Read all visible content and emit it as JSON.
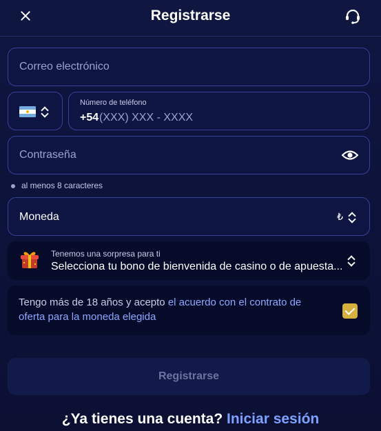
{
  "header": {
    "title": "Registrarse"
  },
  "form": {
    "email_placeholder": "Correo electrónico",
    "phone_label": "Número de teléfono",
    "phone_code": "+54",
    "phone_mask": "(XXX) XXX - XXXX",
    "password_placeholder": "Contraseña",
    "password_hint": "al menos 8 caracteres",
    "currency_label": "Moneda",
    "currency_symbol": "₺"
  },
  "bonus": {
    "small": "Tenemos una sorpresa para ti",
    "big": "Selecciona tu bono de bienvenida de casino o de apuesta..."
  },
  "terms": {
    "text": "Tengo más de 18 años y acepto ",
    "link": "el acuerdo con el contrato de oferta para la moneda elegida",
    "checked": true
  },
  "submit_label": "Registrarse",
  "footer": {
    "question": "¿Ya tienes una cuenta?",
    "login_link": "Iniciar sesión"
  },
  "colors": {
    "background": "#0c1238",
    "accent": "#7ea2ff",
    "checkbox": "#d6b13d"
  },
  "icons": [
    "close-icon",
    "support-icon",
    "argentina-flag-icon",
    "chevron-updown-icon",
    "eye-icon",
    "gift-icon",
    "check-icon"
  ]
}
